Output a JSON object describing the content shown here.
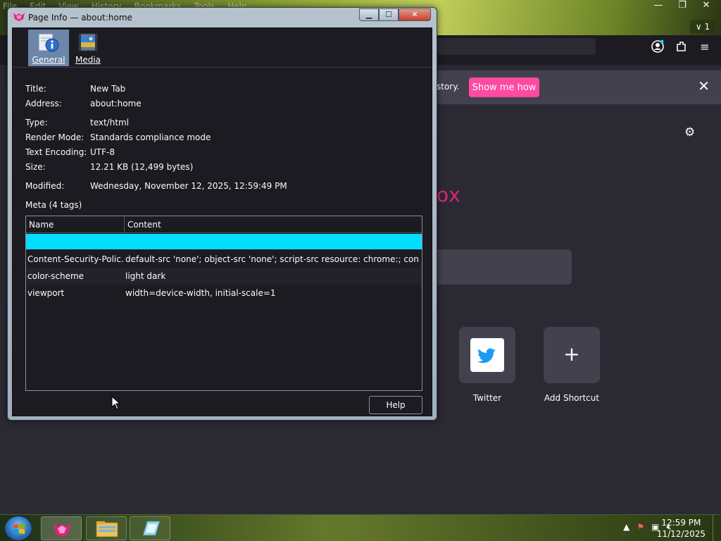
{
  "browser": {
    "menu_faint": [
      "File",
      "Edit",
      "View",
      "History",
      "Bookmarks",
      "Tools",
      "Help"
    ],
    "tab_count": "1",
    "notice_text": "story.",
    "show_me_how": "Show me how",
    "brand_partial": "ox",
    "shortcuts": [
      {
        "label": "Twitter",
        "icon": "twitter-bird-icon"
      },
      {
        "label": "Add Shortcut",
        "icon": "plus-icon"
      }
    ]
  },
  "dialog": {
    "title": "Page Info — about:home",
    "tabs": [
      {
        "label": "General",
        "icon": "info-icon",
        "selected": true
      },
      {
        "label": "Media",
        "icon": "media-icon",
        "selected": false
      }
    ],
    "info": {
      "title_key": "Title:",
      "title_val": "New Tab",
      "address_key": "Address:",
      "address_val": "about:home",
      "type_key": "Type:",
      "type_val": "text/html",
      "render_key": "Render Mode:",
      "render_val": "Standards compliance mode",
      "encoding_key": "Text Encoding:",
      "encoding_val": "UTF-8",
      "size_key": "Size:",
      "size_val": "12.21 KB (12,499 bytes)",
      "modified_key": "Modified:",
      "modified_val": "Wednesday, November 12, 2025, 12:59:49 PM"
    },
    "meta": {
      "heading": "Meta (4 tags)",
      "col_name": "Name",
      "col_content": "Content",
      "rows": [
        {
          "name": "",
          "content": ""
        },
        {
          "name": "Content-Security-Polic...",
          "content": "default-src 'none'; object-src 'none'; script-src resource: chrome:; connect-sr..."
        },
        {
          "name": "color-scheme",
          "content": "light dark"
        },
        {
          "name": "viewport",
          "content": "width=device-width, initial-scale=1"
        }
      ]
    },
    "help_label": "Help"
  },
  "taskbar": {
    "clock_time": "12:59 PM",
    "clock_date": "11/12/2025"
  },
  "colors": {
    "selection": "#00ddff",
    "accent_pink": "#ff4aa2",
    "dialog_bg": "#1c1b22"
  }
}
